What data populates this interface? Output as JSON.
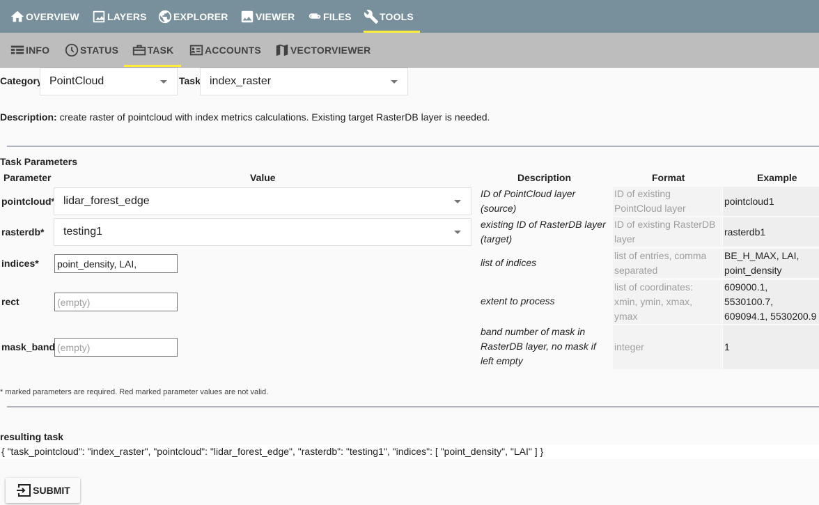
{
  "top_nav": [
    {
      "label": "OVERVIEW",
      "icon": "home-icon"
    },
    {
      "label": "LAYERS",
      "icon": "image-icon"
    },
    {
      "label": "EXPLORER",
      "icon": "globe-icon"
    },
    {
      "label": "VIEWER",
      "icon": "photo-icon"
    },
    {
      "label": "FILES",
      "icon": "attachment-icon"
    },
    {
      "label": "TOOLS",
      "icon": "wrench-icon",
      "active": true
    }
  ],
  "sub_nav": [
    {
      "label": "INFO",
      "icon": "table-icon"
    },
    {
      "label": "STATUS",
      "icon": "clock-icon"
    },
    {
      "label": "TASK",
      "icon": "briefcase-icon",
      "active": true
    },
    {
      "label": "ACCOUNTS",
      "icon": "account-card-icon"
    },
    {
      "label": "VECTORVIEWER",
      "icon": "map-icon"
    }
  ],
  "task_select": {
    "category_label": "Category",
    "category_value": "PointCloud",
    "task_label": "Task",
    "task_value": "index_raster"
  },
  "description": {
    "label": "Description:",
    "text": "create raster of pointcloud with index metrics calculations. Existing target RasterDB layer is needed."
  },
  "params": {
    "section_title": "Task Parameters",
    "headers": {
      "parameter": "Parameter",
      "value": "Value",
      "description": "Description",
      "format": "Format",
      "example": "Example"
    },
    "rows": [
      {
        "name": "pointcloud*",
        "value": "lidar_forest_edge",
        "desc": [
          "ID of PointCloud layer",
          "(source)"
        ],
        "format": [
          "ID of existing",
          "PointCloud layer"
        ],
        "example": [
          "pointcloud1"
        ]
      },
      {
        "name": "rasterdb*",
        "value": "testing1",
        "desc": [
          "existing ID of RasterDB layer",
          "(target)"
        ],
        "format": [
          "ID of existing RasterDB",
          "layer"
        ],
        "example": [
          "rasterdb1"
        ]
      },
      {
        "name": "indices*",
        "value": "point_density, LAI,",
        "desc": [
          "list of indices"
        ],
        "format": [
          "list of entries, comma",
          "separated"
        ],
        "example": [
          "BE_H_MAX, LAI,",
          "point_density"
        ]
      },
      {
        "name": "rect",
        "placeholder": "(empty)",
        "desc": [
          "extent to process"
        ],
        "format": [
          "list of coordinates:",
          "xmin, ymin, xmax,",
          "ymax"
        ],
        "example": [
          "609000.1, 5530100.7,",
          "609094.1, 5530200.9"
        ]
      },
      {
        "name": "mask_band",
        "placeholder": "(empty)",
        "desc": [
          "band number of mask in",
          "RasterDB layer, no mask if",
          "left empty"
        ],
        "format": [
          "integer"
        ],
        "example": [
          "1"
        ]
      }
    ],
    "footnote": "* marked parameters are required. Red marked parameter values are not valid."
  },
  "result": {
    "title": "resulting task",
    "json": "{ \"task_pointcloud\": \"index_raster\", \"pointcloud\": \"lidar_forest_edge\", \"rasterdb\": \"testing1\", \"indices\": [ \"point_density\", \"LAI\" ] }"
  },
  "submit_label": "SUBMIT",
  "colors": {
    "topbar": "#78909c",
    "subbar": "#bdbdbd",
    "active_indicator": "#ffeb3b"
  }
}
